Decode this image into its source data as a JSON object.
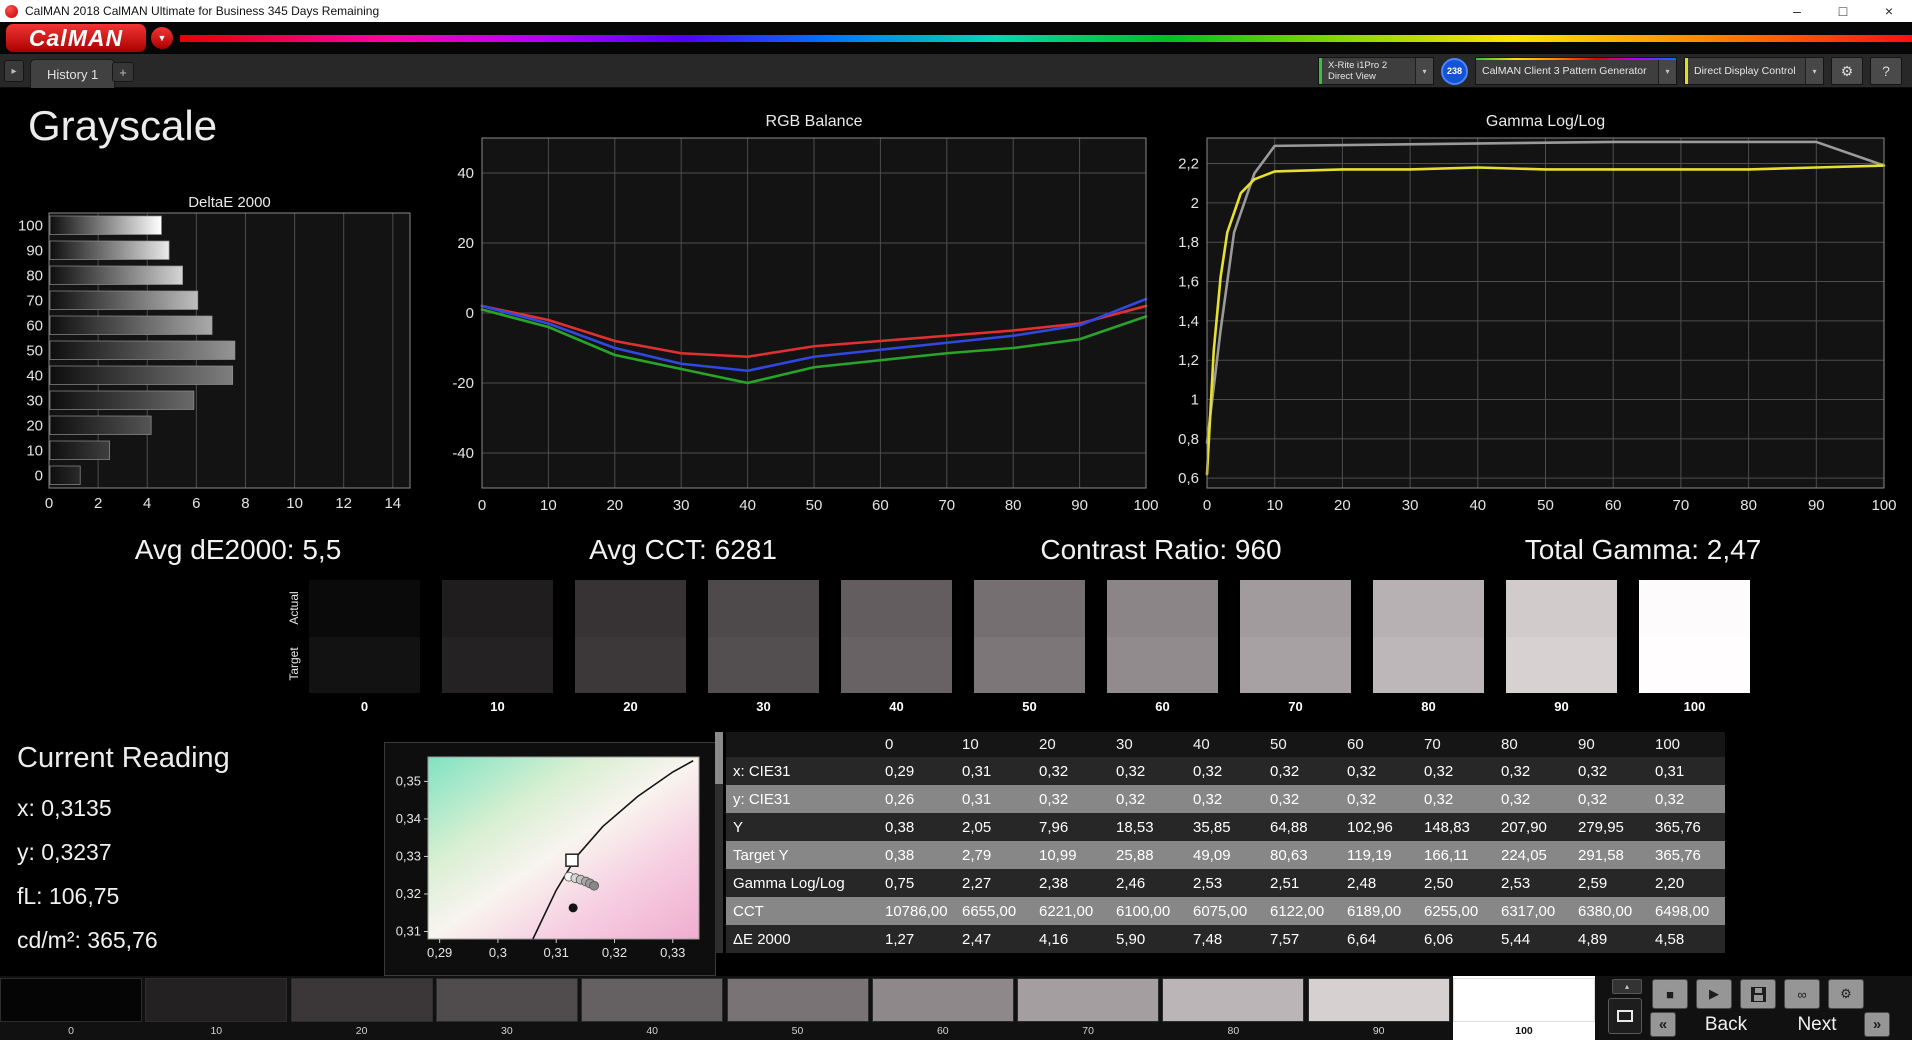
{
  "window": {
    "title": "CalMAN 2018 CalMAN Ultimate for Business 345 Days Remaining"
  },
  "icons": {
    "minimize": "–",
    "maximize": "□",
    "close": "×",
    "logo_arrow": "▼",
    "expander": "▸",
    "dropdown_arrow": "▾",
    "gear": "⚙",
    "chevron_up": "▴",
    "stop": "■",
    "play": "▶",
    "infinity": "∞",
    "back_chevron": "«",
    "next_chevron": "»"
  },
  "brand": {
    "logo_text": "CalMAN"
  },
  "toolbar": {
    "history_tab": "History 1",
    "add_tab": "+",
    "meter_line1": "X-Rite i1Pro 2",
    "meter_line2": "Direct View",
    "meter_badge": "238",
    "pattern_generator": "CalMAN Client 3 Pattern Generator",
    "display_control": "Direct Display Control",
    "help_label": "?"
  },
  "page": {
    "title": "Grayscale"
  },
  "summary": [
    "Avg dE2000: 5,5",
    "Avg CCT: 6281",
    "Contrast Ratio: 960",
    "Total Gamma: 2,47"
  ],
  "swatch_strip": {
    "actual_label": "Actual",
    "target_label": "Target",
    "items": [
      {
        "label": "0",
        "actual": "#0a0a0a",
        "target": "#121212"
      },
      {
        "label": "10",
        "actual": "#201d1e",
        "target": "#252223"
      },
      {
        "label": "20",
        "actual": "#373334",
        "target": "#3c3839"
      },
      {
        "label": "30",
        "actual": "#4e494a",
        "target": "#534e4f"
      },
      {
        "label": "40",
        "actual": "#635d5f",
        "target": "#686264"
      },
      {
        "label": "50",
        "actual": "#756f71",
        "target": "#7c7678"
      },
      {
        "label": "60",
        "actual": "#8b8587",
        "target": "#918b8d"
      },
      {
        "label": "70",
        "actual": "#a19b9d",
        "target": "#a7a1a3"
      },
      {
        "label": "80",
        "actual": "#b7b1b3",
        "target": "#bdb7b9"
      },
      {
        "label": "90",
        "actual": "#d1cbcb",
        "target": "#d7d1d1"
      },
      {
        "label": "100",
        "actual": "#fdfbfb",
        "target": "#fffdfd"
      }
    ]
  },
  "current_reading": {
    "title": "Current Reading",
    "lines": [
      "x: 0,3135",
      "y: 0,3237",
      "fL: 106,75",
      "cd/m²: 365,76"
    ]
  },
  "table": {
    "columns": [
      "",
      "0",
      "10",
      "20",
      "30",
      "40",
      "50",
      "60",
      "70",
      "80",
      "90",
      "100"
    ],
    "rows": [
      {
        "label": "x: CIE31",
        "values": [
          "0,29",
          "0,31",
          "0,32",
          "0,32",
          "0,32",
          "0,32",
          "0,32",
          "0,32",
          "0,32",
          "0,32",
          "0,31"
        ]
      },
      {
        "label": "y: CIE31",
        "values": [
          "0,26",
          "0,31",
          "0,32",
          "0,32",
          "0,32",
          "0,32",
          "0,32",
          "0,32",
          "0,32",
          "0,32",
          "0,32"
        ]
      },
      {
        "label": "Y",
        "values": [
          "0,38",
          "2,05",
          "7,96",
          "18,53",
          "35,85",
          "64,88",
          "102,96",
          "148,83",
          "207,90",
          "279,95",
          "365,76"
        ]
      },
      {
        "label": "Target Y",
        "values": [
          "0,38",
          "2,79",
          "10,99",
          "25,88",
          "49,09",
          "80,63",
          "119,19",
          "166,11",
          "224,05",
          "291,58",
          "365,76"
        ]
      },
      {
        "label": "Gamma Log/Log",
        "values": [
          "0,75",
          "2,27",
          "2,38",
          "2,46",
          "2,53",
          "2,51",
          "2,48",
          "2,50",
          "2,53",
          "2,59",
          "2,20"
        ]
      },
      {
        "label": "CCT",
        "values": [
          "10786,00",
          "6655,00",
          "6221,00",
          "6100,00",
          "6075,00",
          "6122,00",
          "6189,00",
          "6255,00",
          "6317,00",
          "6380,00",
          "6498,00"
        ]
      },
      {
        "label": "ΔE 2000",
        "values": [
          "1,27",
          "2,47",
          "4,16",
          "5,90",
          "7,48",
          "7,57",
          "6,64",
          "6,06",
          "5,44",
          "4,89",
          "4,58"
        ]
      }
    ]
  },
  "bottom_bar": {
    "back_label": "Back",
    "next_label": "Next",
    "patches": [
      {
        "label": "0",
        "color": "#050505"
      },
      {
        "label": "10",
        "color": "#242122"
      },
      {
        "label": "20",
        "color": "#3b3738"
      },
      {
        "label": "30",
        "color": "#504b4c"
      },
      {
        "label": "40",
        "color": "#656061"
      },
      {
        "label": "50",
        "color": "#797375"
      },
      {
        "label": "60",
        "color": "#8e888a"
      },
      {
        "label": "70",
        "color": "#a49ea0"
      },
      {
        "label": "80",
        "color": "#bbb5b7"
      },
      {
        "label": "90",
        "color": "#d6d0d0"
      },
      {
        "label": "100",
        "color": "#ffffff",
        "active": true
      }
    ]
  },
  "chart_data": [
    {
      "type": "bar",
      "title": "DeltaE 2000",
      "orientation": "horizontal",
      "categories": [
        100,
        90,
        80,
        70,
        60,
        50,
        40,
        30,
        20,
        10,
        0
      ],
      "values": [
        4.58,
        4.89,
        5.44,
        6.06,
        6.64,
        7.57,
        7.48,
        5.9,
        4.16,
        2.47,
        1.27
      ],
      "xlim": [
        0,
        14.7
      ],
      "xticks": [
        0,
        2,
        4,
        6,
        8,
        10,
        12,
        14
      ]
    },
    {
      "type": "line",
      "title": "RGB Balance",
      "x": [
        0,
        10,
        20,
        30,
        40,
        50,
        60,
        70,
        80,
        90,
        100
      ],
      "series": [
        {
          "name": "Red",
          "color": "#e03030",
          "values": [
            2,
            -2,
            -8,
            -11.5,
            -12.5,
            -9.5,
            -8,
            -6.5,
            -5,
            -3,
            2
          ]
        },
        {
          "name": "Green",
          "color": "#28a428",
          "values": [
            1,
            -4,
            -12,
            -16,
            -20,
            -15.5,
            -13.5,
            -11.5,
            -10,
            -7.5,
            -1
          ]
        },
        {
          "name": "Blue",
          "color": "#3048e0",
          "values": [
            2,
            -3,
            -10,
            -14.5,
            -16.5,
            -12.5,
            -10.5,
            -8.5,
            -6.5,
            -3.5,
            4
          ]
        }
      ],
      "ylim": [
        -50,
        50
      ],
      "yticks": [
        40,
        20,
        0,
        -20,
        -40
      ],
      "xticks": [
        0,
        10,
        20,
        30,
        40,
        50,
        60,
        70,
        80,
        90,
        100
      ]
    },
    {
      "type": "line",
      "title": "Gamma Log/Log",
      "series": [
        {
          "name": "Target",
          "color": "#9a9a9a",
          "points": [
            [
              0,
              0.78
            ],
            [
              2,
              1.35
            ],
            [
              4,
              1.85
            ],
            [
              7,
              2.15
            ],
            [
              10,
              2.29
            ],
            [
              60,
              2.31
            ],
            [
              90,
              2.31
            ],
            [
              100,
              2.19
            ]
          ]
        },
        {
          "name": "Measured",
          "color": "#e8e030",
          "points": [
            [
              0,
              0.62
            ],
            [
              1,
              1.25
            ],
            [
              2,
              1.62
            ],
            [
              3,
              1.85
            ],
            [
              5,
              2.05
            ],
            [
              7,
              2.12
            ],
            [
              10,
              2.16
            ],
            [
              20,
              2.17
            ],
            [
              30,
              2.17
            ],
            [
              40,
              2.18
            ],
            [
              50,
              2.17
            ],
            [
              60,
              2.17
            ],
            [
              70,
              2.17
            ],
            [
              80,
              2.17
            ],
            [
              90,
              2.18
            ],
            [
              100,
              2.19
            ]
          ]
        }
      ],
      "ylim": [
        0.55,
        2.33
      ],
      "yticks": [
        2.2,
        2.0,
        1.8,
        1.6,
        1.4,
        1.2,
        1.0,
        0.8,
        0.6
      ],
      "ytick_labels": [
        "2,2",
        "2",
        "1,8",
        "1,6",
        "1,4",
        "1,2",
        "1",
        "0,8",
        "0,6"
      ],
      "xticks": [
        0,
        10,
        20,
        30,
        40,
        50,
        60,
        70,
        80,
        90,
        100
      ]
    },
    {
      "type": "scatter",
      "title": "CIE 1931 chromaticity",
      "xlim": [
        0.288,
        0.3345
      ],
      "ylim": [
        0.308,
        0.3565
      ],
      "xticks": [
        0.29,
        0.3,
        0.31,
        0.32,
        0.33
      ],
      "xtick_labels": [
        "0,29",
        "0,3",
        "0,31",
        "0,32",
        "0,33"
      ],
      "yticks": [
        0.35,
        0.34,
        0.33,
        0.32,
        0.31
      ],
      "ytick_labels": [
        "0,35",
        "0,34",
        "0,33",
        "0,32",
        "0,31"
      ],
      "locus": [
        [
          0.306,
          0.308
        ],
        [
          0.31,
          0.321
        ],
        [
          0.3135,
          0.33
        ],
        [
          0.318,
          0.338
        ],
        [
          0.324,
          0.346
        ],
        [
          0.33,
          0.3525
        ],
        [
          0.3335,
          0.3555
        ]
      ],
      "target_square": [
        0.3127,
        0.329
      ],
      "points": [
        {
          "x": 0.3122,
          "y": 0.3246,
          "color": "#f5f5f5"
        },
        {
          "x": 0.3133,
          "y": 0.3242,
          "color": "#d8d8d8"
        },
        {
          "x": 0.3142,
          "y": 0.3238,
          "color": "#c0c0c0"
        },
        {
          "x": 0.3151,
          "y": 0.3233,
          "color": "#a8a8a8"
        },
        {
          "x": 0.3158,
          "y": 0.3228,
          "color": "#989898"
        },
        {
          "x": 0.3165,
          "y": 0.3222,
          "color": "#888888"
        }
      ],
      "black_point": [
        0.3129,
        0.3163
      ]
    }
  ]
}
